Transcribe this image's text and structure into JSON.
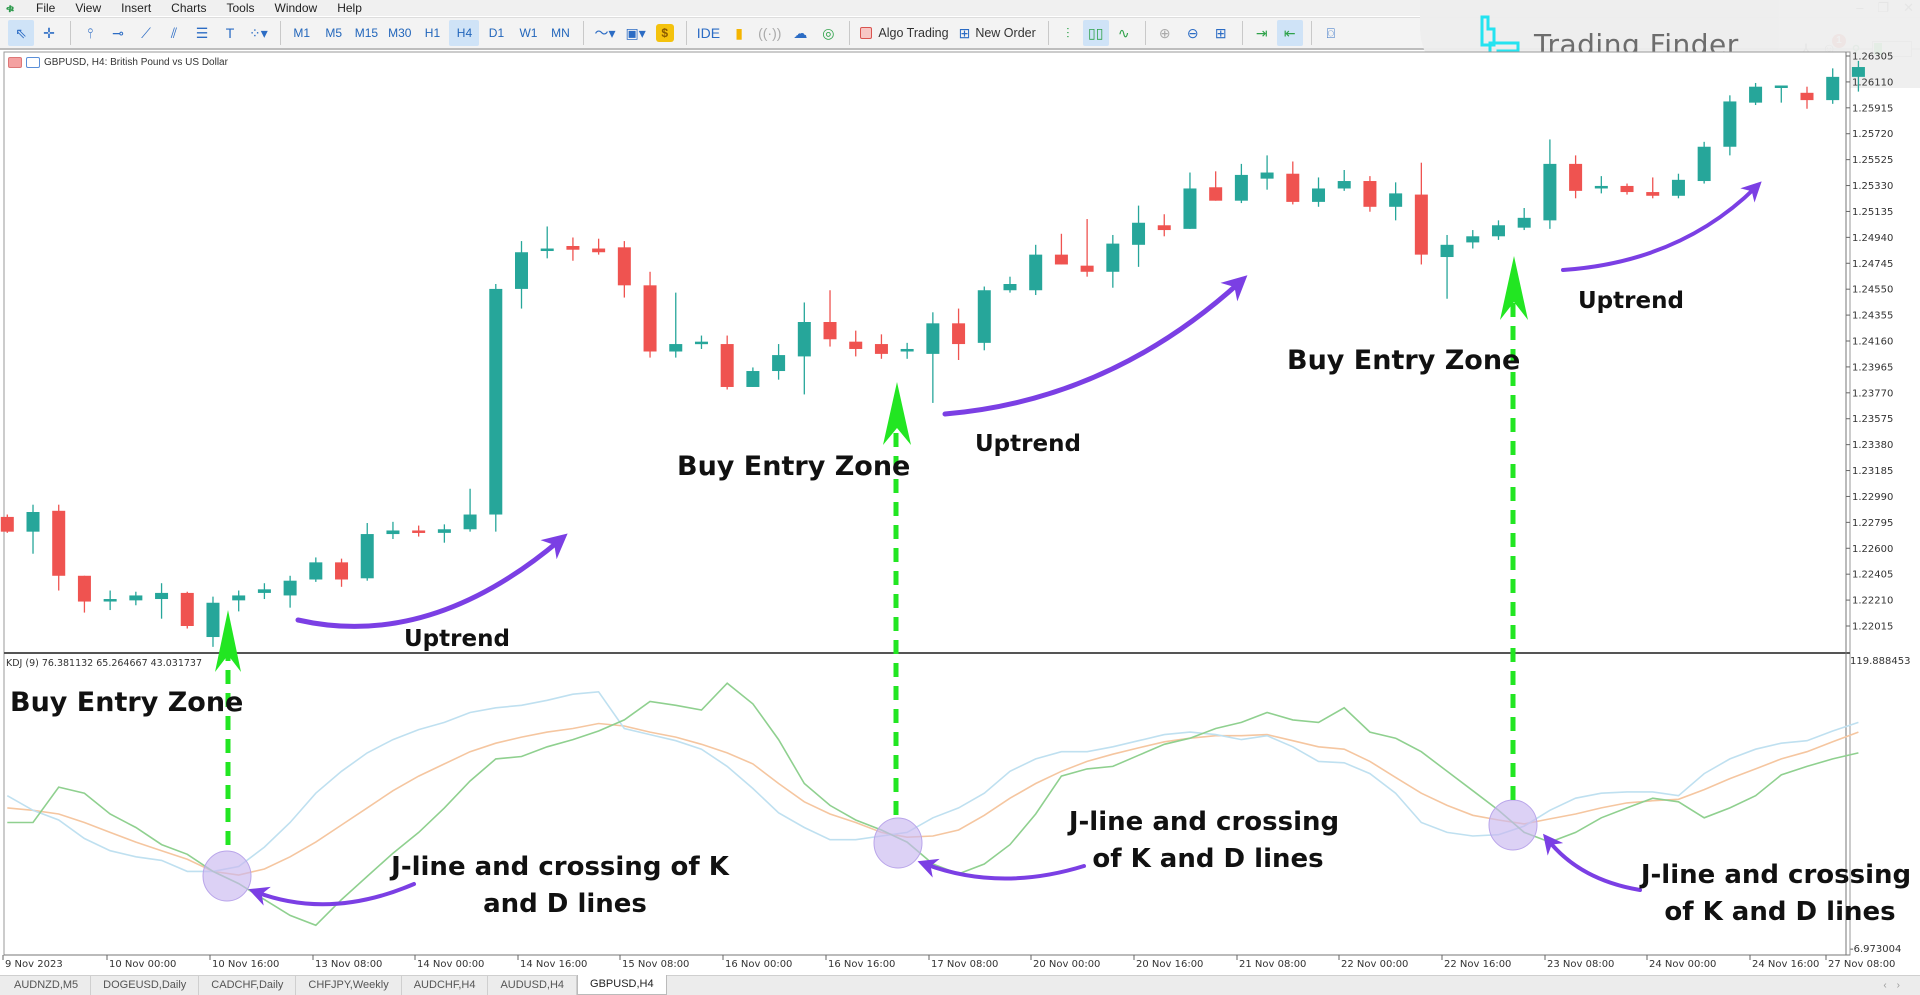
{
  "menu": {
    "items": [
      "File",
      "View",
      "Insert",
      "Charts",
      "Tools",
      "Window",
      "Help"
    ]
  },
  "toolbar": {
    "timeframes": [
      "M1",
      "M5",
      "M15",
      "M30",
      "H1",
      "H4",
      "D1",
      "W1",
      "MN"
    ],
    "active_timeframe": "H4",
    "ide_label": "IDE",
    "algo_trading_label": "Algo Trading",
    "new_order_label": "New Order",
    "notification_count": "1",
    "signal_level": 0.2
  },
  "watermark": {
    "text": "Trading Finder"
  },
  "chart": {
    "header": "GBPUSD, H4:  British Pound vs US Dollar",
    "indicator_header": "KDJ (9) 76.381132 65.264667 43.031737",
    "indicator_max_label": "119.888453",
    "indicator_min_label": "-6.973004",
    "colors": {
      "bull": "#26a69a",
      "bear": "#ef5350",
      "k_line": "#f5c6a0",
      "d_line": "#bfe0f0",
      "j_line": "#8fd08f",
      "annotation_arrow": "#7b3fe4",
      "entry_arrow": "#22e622",
      "highlight_circle": "#c9b8f0"
    }
  },
  "chart_data": [
    {
      "type": "candlestick",
      "title": "GBPUSD, H4: British Pound vs US Dollar",
      "ylabel": "Price",
      "ylim": [
        1.22015,
        1.26305
      ],
      "yticks": [
        "1.26305",
        "1.26110",
        "1.25915",
        "1.25720",
        "1.25525",
        "1.25330",
        "1.25135",
        "1.24940",
        "1.24745",
        "1.24550",
        "1.24355",
        "1.24160",
        "1.23965",
        "1.23770",
        "1.23575",
        "1.23380",
        "1.23185",
        "1.22990",
        "1.22795",
        "1.22600",
        "1.22405",
        "1.22210",
        "1.22015"
      ],
      "xticks": [
        "9 Nov 2023",
        "10 Nov 00:00",
        "10 Nov 16:00",
        "13 Nov 08:00",
        "14 Nov 00:00",
        "14 Nov 16:00",
        "15 Nov 08:00",
        "16 Nov 00:00",
        "16 Nov 16:00",
        "17 Nov 08:00",
        "20 Nov 00:00",
        "20 Nov 16:00",
        "21 Nov 08:00",
        "22 Nov 00:00",
        "22 Nov 16:00",
        "23 Nov 08:00",
        "24 Nov 00:00",
        "24 Nov 16:00",
        "27 Nov 08:00"
      ],
      "candles": [
        [
          1.22836,
          1.22725,
          1.22854,
          1.22716
        ],
        [
          1.22725,
          1.22873,
          1.22928,
          1.22559
        ],
        [
          1.22882,
          1.22393,
          1.22928,
          1.22282
        ],
        [
          1.22393,
          1.22199,
          1.22393,
          1.22116
        ],
        [
          1.22208,
          1.22218,
          1.22282,
          1.22135
        ],
        [
          1.22208,
          1.22245,
          1.22273,
          1.22171
        ],
        [
          1.22218,
          1.22264,
          1.22337,
          1.2207
        ],
        [
          1.22264,
          1.22015,
          1.22273,
          1.21996
        ],
        [
          1.21932,
          1.2219,
          1.22236,
          1.21858
        ],
        [
          1.22208,
          1.22245,
          1.22282,
          1.22125
        ],
        [
          1.22264,
          1.22291,
          1.22337,
          1.22218
        ],
        [
          1.22245,
          1.22356,
          1.22393,
          1.22153
        ],
        [
          1.22365,
          1.22494,
          1.22531,
          1.22347
        ],
        [
          1.22494,
          1.22365,
          1.22522,
          1.2231
        ],
        [
          1.22374,
          1.22707,
          1.2279,
          1.22356
        ],
        [
          1.22707,
          1.22734,
          1.22799,
          1.2267
        ],
        [
          1.22734,
          1.22725,
          1.22771,
          1.22688
        ],
        [
          1.22716,
          1.22743,
          1.2278,
          1.22642
        ],
        [
          1.22743,
          1.22854,
          1.23048,
          1.22725
        ],
        [
          1.22854,
          1.24552,
          1.24589,
          1.22725
        ],
        [
          1.24552,
          1.24828,
          1.24912,
          1.24404
        ],
        [
          1.24838,
          1.24856,
          1.25022,
          1.24782
        ],
        [
          1.24875,
          1.24847,
          1.24939,
          1.24764
        ],
        [
          1.24856,
          1.24828,
          1.2493,
          1.2481
        ],
        [
          1.24865,
          1.24579,
          1.24912,
          1.24487
        ],
        [
          1.24579,
          1.24081,
          1.24681,
          1.24035
        ],
        [
          1.24081,
          1.24137,
          1.24524,
          1.24035
        ],
        [
          1.24155,
          1.24155,
          1.24201,
          1.241
        ],
        [
          1.24137,
          1.23814,
          1.24201,
          1.23795
        ],
        [
          1.23814,
          1.23934,
          1.23961,
          1.23814
        ],
        [
          1.23934,
          1.24054,
          1.24137,
          1.23869
        ],
        [
          1.24044,
          1.24303,
          1.2445,
          1.23758
        ],
        [
          1.24303,
          1.24173,
          1.24542,
          1.24118
        ],
        [
          1.24155,
          1.241,
          1.24238,
          1.24044
        ],
        [
          1.24137,
          1.24063,
          1.2421,
          1.24026
        ],
        [
          1.24081,
          1.241,
          1.24146,
          1.24026
        ],
        [
          1.24063,
          1.24293,
          1.24376,
          1.23694
        ],
        [
          1.24293,
          1.24137,
          1.24404,
          1.24017
        ],
        [
          1.24146,
          1.24542,
          1.2457,
          1.2409
        ],
        [
          1.24542,
          1.24589,
          1.24644,
          1.24524
        ],
        [
          1.24542,
          1.2481,
          1.24884,
          1.24506
        ],
        [
          1.2481,
          1.24736,
          1.24967,
          1.24736
        ],
        [
          1.24727,
          1.24681,
          1.25078,
          1.24644
        ],
        [
          1.24681,
          1.24893,
          1.24958,
          1.24561
        ],
        [
          1.24884,
          1.2505,
          1.25179,
          1.24718
        ],
        [
          1.25031,
          1.24995,
          1.25114,
          1.24948
        ],
        [
          1.25004,
          1.25308,
          1.25428,
          1.25004
        ],
        [
          1.25317,
          1.25216,
          1.25437,
          1.25216
        ],
        [
          1.25216,
          1.2541,
          1.25493,
          1.25198
        ],
        [
          1.25382,
          1.25428,
          1.25557,
          1.25299
        ],
        [
          1.25419,
          1.25207,
          1.25511,
          1.25188
        ],
        [
          1.25207,
          1.25308,
          1.25391,
          1.2517
        ],
        [
          1.25308,
          1.25364,
          1.25447,
          1.2529
        ],
        [
          1.25364,
          1.2517,
          1.25401,
          1.25133
        ],
        [
          1.2517,
          1.25271,
          1.25354,
          1.25068
        ],
        [
          1.25262,
          1.2481,
          1.25502,
          1.24736
        ],
        [
          1.24792,
          1.24884,
          1.24958,
          1.24478
        ],
        [
          1.24902,
          1.24948,
          1.24995,
          1.24856
        ],
        [
          1.24948,
          1.25031,
          1.25068,
          1.24921
        ],
        [
          1.25013,
          1.25087,
          1.25161,
          1.24995
        ],
        [
          1.25068,
          1.25493,
          1.25677,
          1.25004
        ],
        [
          1.25493,
          1.2529,
          1.25557,
          1.25234
        ],
        [
          1.25308,
          1.25327,
          1.25401,
          1.25271
        ],
        [
          1.25327,
          1.25281,
          1.25345,
          1.25262
        ],
        [
          1.25281,
          1.25253,
          1.25391,
          1.25234
        ],
        [
          1.25253,
          1.25373,
          1.25419,
          1.25234
        ],
        [
          1.25364,
          1.25622,
          1.25659,
          1.25345
        ],
        [
          1.25622,
          1.25963,
          1.26009,
          1.25557
        ],
        [
          1.25954,
          1.26074,
          1.26102,
          1.25936
        ],
        [
          1.26074,
          1.26083,
          1.26083,
          1.25954
        ],
        [
          1.26028,
          1.25973,
          1.26074,
          1.25908
        ],
        [
          1.25973,
          1.26148,
          1.26212,
          1.25945
        ],
        [
          1.26148,
          1.26222,
          1.26268,
          1.26037
        ]
      ],
      "candle_format": [
        "open",
        "close",
        "high",
        "low"
      ]
    },
    {
      "type": "line",
      "title": "KDJ (9)",
      "ylim": [
        -6.973004,
        119.888453
      ],
      "series": [
        {
          "name": "K",
          "values": [
            54.3,
            53.2,
            51.6,
            47.8,
            43.4,
            39.1,
            35.3,
            31.5,
            26.1,
            24.5,
            27.2,
            32.6,
            39.1,
            46.7,
            54.3,
            61.9,
            68.4,
            73.8,
            79.2,
            83.0,
            85.7,
            87.9,
            89.5,
            91.7,
            90.6,
            87.9,
            85.7,
            82.5,
            78.7,
            73.8,
            65.1,
            57.0,
            51.6,
            47.8,
            43.4,
            41.3,
            41.8,
            44.5,
            51.0,
            58.6,
            65.1,
            70.5,
            74.9,
            78.1,
            80.9,
            83.6,
            85.2,
            86.3,
            86.3,
            86.8,
            84.1,
            81.4,
            80.3,
            74.9,
            67.8,
            60.8,
            55.4,
            51.0,
            48.9,
            47.2,
            49.4,
            51.6,
            54.3,
            56.5,
            57.5,
            58.1,
            62.4,
            67.3,
            71.6,
            76.0,
            79.2,
            83.6,
            87.9
          ]
        },
        {
          "name": "D",
          "values": [
            59.7,
            53.2,
            48.9,
            40.7,
            35.3,
            32.6,
            31.0,
            26.1,
            26.1,
            28.3,
            36.9,
            47.8,
            60.8,
            70.5,
            78.7,
            84.6,
            89.0,
            92.2,
            96.6,
            98.7,
            99.8,
            102.0,
            104.7,
            105.8,
            89.5,
            86.8,
            84.1,
            80.3,
            72.7,
            62.9,
            52.1,
            45.6,
            40.2,
            40.2,
            41.8,
            43.4,
            49.9,
            54.3,
            60.8,
            70.5,
            76.0,
            79.2,
            79.2,
            81.4,
            84.1,
            86.8,
            87.9,
            86.8,
            84.6,
            86.3,
            81.4,
            74.9,
            74.3,
            69.5,
            60.8,
            47.8,
            43.4,
            41.8,
            42.4,
            46.2,
            53.2,
            58.6,
            60.8,
            61.4,
            61.4,
            59.7,
            69.5,
            76.0,
            80.3,
            83.0,
            84.1,
            88.4,
            92.2
          ]
        },
        {
          "name": "J",
          "values": [
            47.8,
            47.8,
            63.5,
            60.8,
            51.6,
            45.6,
            38.0,
            33.7,
            26.1,
            20.7,
            13.6,
            6.6,
            2.2,
            13.6,
            23.9,
            34.2,
            43.4,
            54.3,
            66.2,
            76.0,
            77.1,
            81.4,
            84.6,
            88.4,
            93.3,
            101.5,
            99.8,
            97.7,
            109.6,
            100.4,
            84.6,
            65.1,
            55.4,
            48.9,
            44.5,
            39.1,
            29.4,
            25.0,
            29.4,
            38.0,
            51.6,
            68.4,
            71.6,
            72.7,
            77.6,
            82.5,
            85.2,
            89.5,
            92.2,
            96.6,
            93.3,
            92.2,
            98.7,
            87.9,
            85.2,
            79.2,
            70.5,
            61.9,
            53.2,
            43.4,
            39.1,
            43.4,
            49.9,
            54.3,
            58.6,
            57.0,
            49.9,
            54.3,
            59.7,
            68.9,
            72.7,
            76.0,
            78.7
          ]
        }
      ]
    }
  ],
  "annotations": {
    "buy_entry_zone": "Buy Entry Zone",
    "uptrend": "Uptrend",
    "jline_1a": "J-line and crossing of K",
    "jline_1b": "and D lines",
    "jline_2a": "J-line and crossing",
    "jline_2b": "of K and D lines"
  },
  "tabs": {
    "items": [
      "AUDNZD,M5",
      "DOGEUSD,Daily",
      "CADCHF,Daily",
      "CHFJPY,Weekly",
      "AUDCHF,H4",
      "AUDUSD,H4",
      "GBPUSD,H4"
    ],
    "active": "GBPUSD,H4"
  }
}
